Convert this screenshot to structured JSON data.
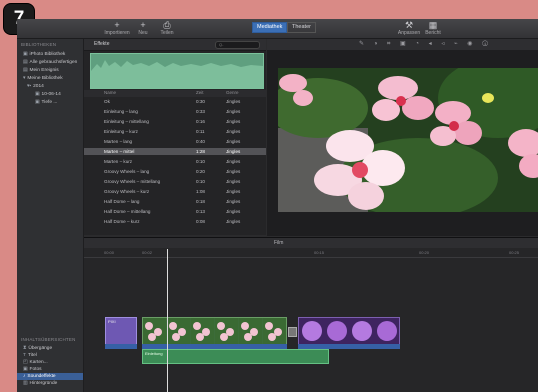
{
  "step_badge": "7",
  "toolbar": {
    "buttons": [
      {
        "label": "Importieren",
        "icon": "plus-icon"
      },
      {
        "label": "Neu",
        "icon": "plus-icon"
      },
      {
        "label": "Teilen",
        "icon": "share-icon"
      }
    ],
    "segments": [
      "Mediathek",
      "Theater"
    ],
    "right_buttons": [
      {
        "label": "Anpassen",
        "icon": "wrench-icon"
      },
      {
        "label": "Bericht",
        "icon": "grid-icon"
      }
    ]
  },
  "sidebar": {
    "heading_top": "BIBLIOTHEKEN",
    "items_top": [
      "iPhoto Bibliothek",
      "Alle gebrauchsfertigen",
      "Mein Ereignis",
      "Meine Bibliothek",
      "2014",
      "10-06-14",
      "Tiefe ..."
    ],
    "heading_bottom": "INHALTSÜBERSICHTEN",
    "items_bottom": [
      "Übergänge",
      "Titel",
      "Karten...",
      "Fotos",
      "Soundeffekte",
      "Hintergründe"
    ],
    "selected_bottom_index": 4
  },
  "browser": {
    "title": "Effekte",
    "search_placeholder": "Q-",
    "columns": [
      "Name",
      "Zeit",
      "Genre"
    ],
    "rows": [
      {
        "name": "Ok",
        "time": "0:30",
        "genre": "Jingles"
      },
      {
        "name": "Einleitung – lang",
        "time": "0:33",
        "genre": "Jingles"
      },
      {
        "name": "Einleitung – mittellang",
        "time": "0:16",
        "genre": "Jingles"
      },
      {
        "name": "Einleitung – kurz",
        "time": "0:11",
        "genre": "Jingles"
      },
      {
        "name": "Marten – lang",
        "time": "0:40",
        "genre": "Jingles"
      },
      {
        "name": "Marten – mittel",
        "time": "1:28",
        "genre": "Jingles"
      },
      {
        "name": "Marten – kurz",
        "time": "0:10",
        "genre": "Jingles"
      },
      {
        "name": "Groovy Wheels – lang",
        "time": "0:20",
        "genre": "Jingles"
      },
      {
        "name": "Groovy Wheels – mittellang",
        "time": "0:10",
        "genre": "Jingles"
      },
      {
        "name": "Groovy Wheels – kurz",
        "time": "1:08",
        "genre": "Jingles"
      },
      {
        "name": "Half Dome – lang",
        "time": "0:18",
        "genre": "Jingles"
      },
      {
        "name": "Half Dome – mittellang",
        "time": "0:13",
        "genre": "Jingles"
      },
      {
        "name": "Half Dome – kurz",
        "time": "0:08",
        "genre": "Jingles"
      }
    ],
    "selected_index": 5
  },
  "timeline": {
    "title": "Film",
    "ruler_ticks": [
      "00:00",
      "00:02",
      "00:15",
      "00:20",
      "00:25"
    ],
    "purple_clip_label": "PIXI",
    "music_label": "Einleitung"
  },
  "colors": {
    "accent": "#3b6fb6",
    "waveform": "#5f9f7f",
    "audio_clip": "#3c8c56",
    "badge_bg": "#1b1b1b",
    "page_bg": "#d98a86"
  }
}
